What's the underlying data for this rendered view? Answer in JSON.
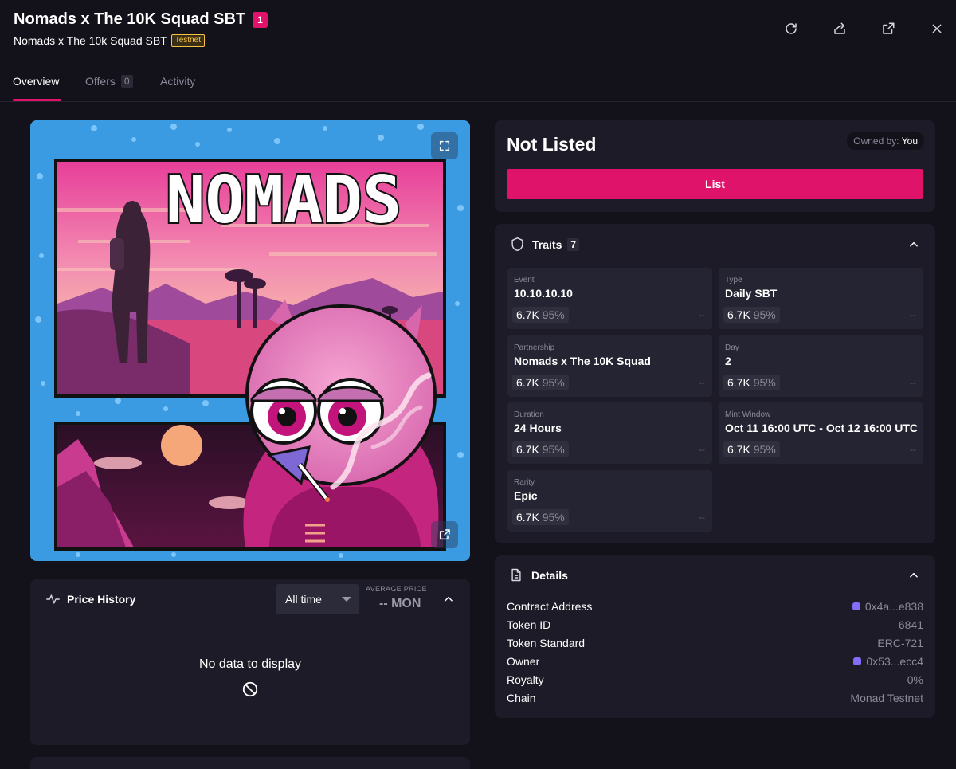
{
  "header": {
    "title": "Nomads x The 10K Squad SBT",
    "count_badge": "1",
    "subtitle": "Nomads x The 10k Squad SBT",
    "network_badge": "Testnet",
    "icons": [
      "refresh-icon",
      "share-icon",
      "external-link-icon",
      "close-icon"
    ]
  },
  "tabs": [
    {
      "label": "Overview",
      "active": true
    },
    {
      "label": "Offers",
      "count": "0"
    },
    {
      "label": "Activity"
    }
  ],
  "image": {
    "artwork_text": "NOMADS",
    "icons": [
      "fullscreen-icon",
      "open-external-icon"
    ]
  },
  "price_history": {
    "title": "Price History",
    "range_select": "All time",
    "avg_label": "AVERAGE PRICE",
    "avg_value": "-- MON",
    "empty_text": "No data to display"
  },
  "listing": {
    "status": "Not Listed",
    "owned_by_label": "Owned by:",
    "owned_by_value": "You",
    "list_button": "List"
  },
  "traits": {
    "title": "Traits",
    "count": "7",
    "items": [
      {
        "key": "Event",
        "value": "10.10.10.10",
        "count": "6.7K",
        "pct": "95%",
        "price": "--"
      },
      {
        "key": "Type",
        "value": "Daily SBT",
        "count": "6.7K",
        "pct": "95%",
        "price": "--"
      },
      {
        "key": "Partnership",
        "value": "Nomads x The 10K Squad",
        "count": "6.7K",
        "pct": "95%",
        "price": "--"
      },
      {
        "key": "Day",
        "value": "2",
        "count": "6.7K",
        "pct": "95%",
        "price": "--"
      },
      {
        "key": "Duration",
        "value": "24 Hours",
        "count": "6.7K",
        "pct": "95%",
        "price": "--"
      },
      {
        "key": "Mint Window",
        "value": "Oct 11 16:00 UTC - Oct 12 16:00 UTC",
        "count": "6.7K",
        "pct": "95%",
        "price": "--"
      },
      {
        "key": "Rarity",
        "value": "Epic",
        "count": "6.7K",
        "pct": "95%",
        "price": "--"
      }
    ]
  },
  "details": {
    "title": "Details",
    "rows": [
      {
        "key": "Contract Address",
        "value": "0x4a...e838",
        "icon": "monad-icon"
      },
      {
        "key": "Token ID",
        "value": "6841"
      },
      {
        "key": "Token Standard",
        "value": "ERC-721"
      },
      {
        "key": "Owner",
        "value": "0x53...ecc4",
        "icon": "monad-icon"
      },
      {
        "key": "Royalty",
        "value": "0%"
      },
      {
        "key": "Chain",
        "value": "Monad Testnet"
      }
    ]
  },
  "colors": {
    "background": "#13121b",
    "card": "#1c1b27",
    "accent": "#e0136b",
    "testnet": "#f6c244",
    "artwork_border": "#3b9be2"
  }
}
